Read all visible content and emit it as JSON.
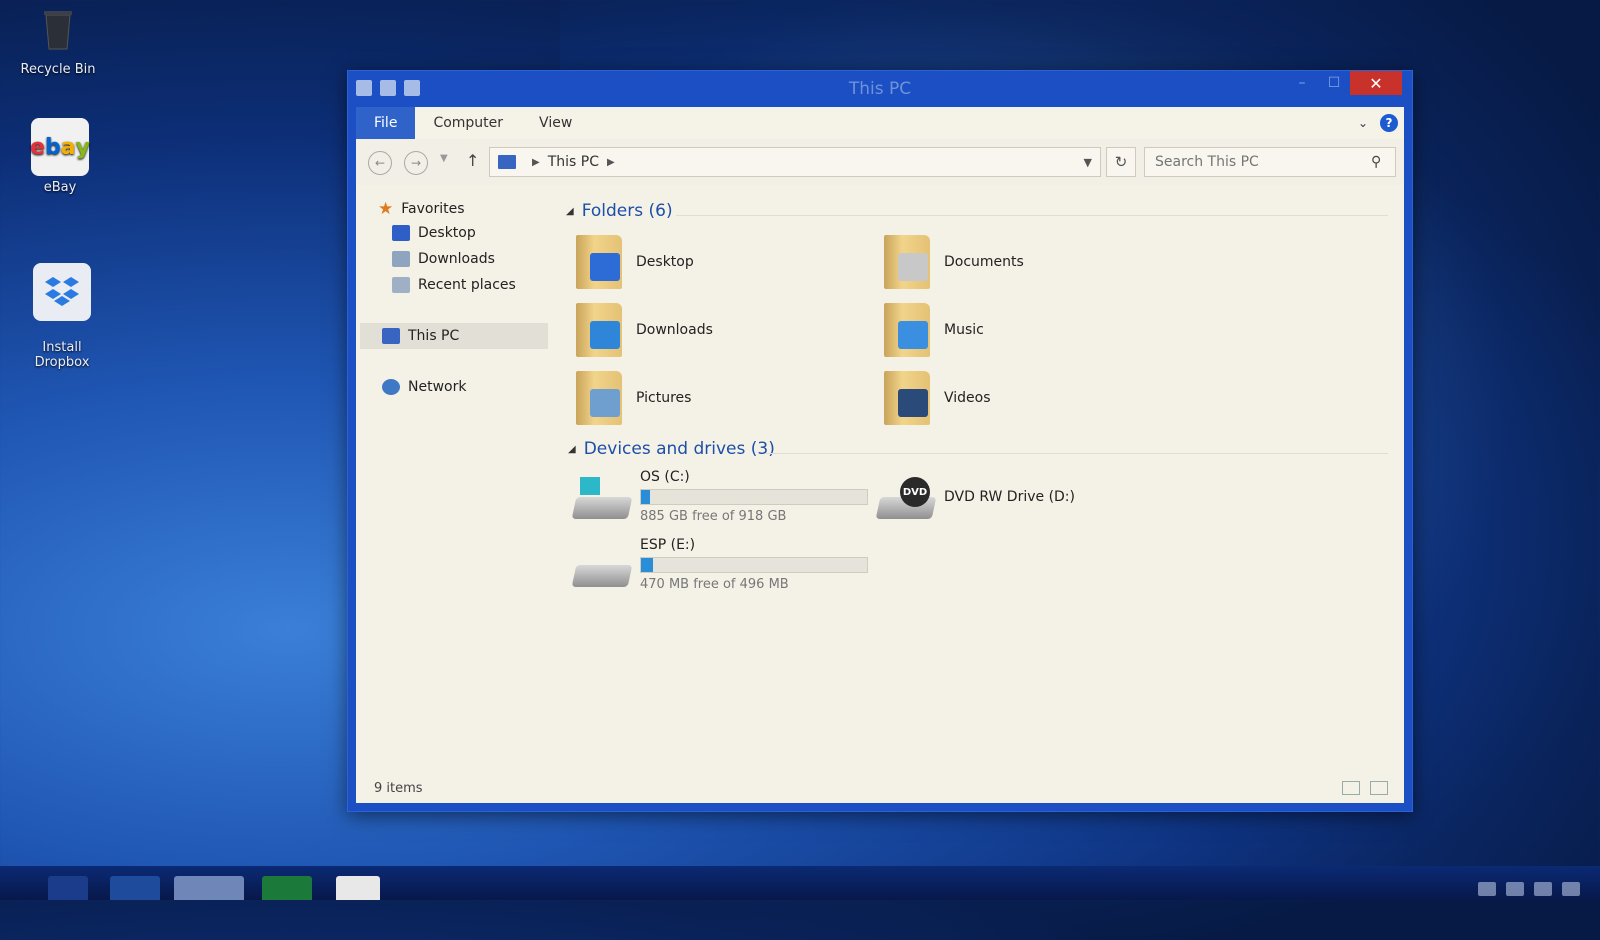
{
  "desktop": {
    "icons": [
      {
        "label": "Recycle Bin"
      },
      {
        "label": "eBay",
        "logo": [
          "e",
          "b",
          "a",
          "y"
        ]
      },
      {
        "label": "Install\nDropbox"
      }
    ]
  },
  "window": {
    "title": "This PC",
    "close_glyph": "✕",
    "ribbon_tabs": [
      "File",
      "Computer",
      "View"
    ],
    "help_glyph": "?",
    "address": {
      "crumbs": [
        "This PC"
      ],
      "separator": "▶"
    },
    "search": {
      "placeholder": "Search This PC"
    },
    "nav": {
      "favorites_label": "Favorites",
      "favorites": [
        "Desktop",
        "Downloads",
        "Recent places"
      ],
      "this_pc": "This PC",
      "network": "Network"
    },
    "groups": {
      "folders": {
        "title": "Folders (6)"
      },
      "devices": {
        "title": "Devices and drives (3)"
      }
    },
    "folders": [
      {
        "name": "Desktop",
        "color": "#2d6bd6"
      },
      {
        "name": "Documents",
        "color": "#c8c8c8"
      },
      {
        "name": "Downloads",
        "color": "#2f86d8"
      },
      {
        "name": "Music",
        "color": "#3a8fe0"
      },
      {
        "name": "Pictures",
        "color": "#6f9fcf"
      },
      {
        "name": "Videos",
        "color": "#2a4a7a"
      }
    ],
    "drives": [
      {
        "name": "OS (C:)",
        "free_text": "885 GB free of 918 GB",
        "used_fraction": 0.036
      },
      {
        "name": "ESP (E:)",
        "free_text": "470 MB free of 496 MB",
        "used_fraction": 0.052
      },
      {
        "name": "DVD RW Drive (D:)",
        "badge": "DVD"
      }
    ],
    "status": {
      "items_text": "9 items"
    }
  },
  "colors": {
    "accent": "#2f63c9",
    "close": "#c9322b",
    "drive_bar": "#2a8dd8"
  }
}
